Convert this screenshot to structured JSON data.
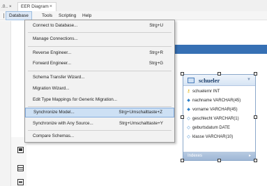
{
  "tabs": {
    "left_label": ".0..",
    "left_close": "×",
    "active_label": "EER Diagram",
    "active_close": "×"
  },
  "menubar": {
    "items": [
      "Database",
      "Tools",
      "Scripting",
      "Help"
    ]
  },
  "database_menu": {
    "items": [
      {
        "label": "Connect to Database...",
        "shortcut": "Strg+U"
      },
      {
        "label": "Manage Connections...",
        "shortcut": ""
      },
      {
        "label": "Reverse Engineer...",
        "shortcut": "Strg+R"
      },
      {
        "label": "Forward Engineer...",
        "shortcut": "Strg+G"
      },
      {
        "label": "Schema Transfer Wizard...",
        "shortcut": ""
      },
      {
        "label": "Migration Wizard...",
        "shortcut": ""
      },
      {
        "label": "Edit Type Mappings for Generic Migration...",
        "shortcut": ""
      },
      {
        "label": "Synchronize Model...",
        "shortcut": "Strg+Umschalttaste+Z"
      },
      {
        "label": "Synchronize with Any Source...",
        "shortcut": "Strg+Umschalttaste+Y"
      },
      {
        "label": "Compare Schemas...",
        "shortcut": ""
      }
    ],
    "highlighted": "Synchronize Model..."
  },
  "entity": {
    "title": "schueler",
    "columns": [
      {
        "text": "schuelernr INT",
        "icon": "primary-key-icon"
      },
      {
        "text": "nachname VARCHAR(45)",
        "icon": "column-diamond-icon"
      },
      {
        "text": "vorname VARCHAR(45)",
        "icon": "column-diamond-icon"
      },
      {
        "text": "geschlecht VARCHAR(1)",
        "icon": "nullable-diamond-icon"
      },
      {
        "text": "geburtsdatum DATE",
        "icon": "nullable-diamond-icon"
      },
      {
        "text": "klasse VARCHAR(10)",
        "icon": "nullable-diamond-icon"
      }
    ],
    "footer": "Indexes"
  },
  "colors": {
    "accent_band": "#3670b4",
    "menu_highlight": "#cde0f4",
    "entity_title": "#1d3f6c"
  }
}
